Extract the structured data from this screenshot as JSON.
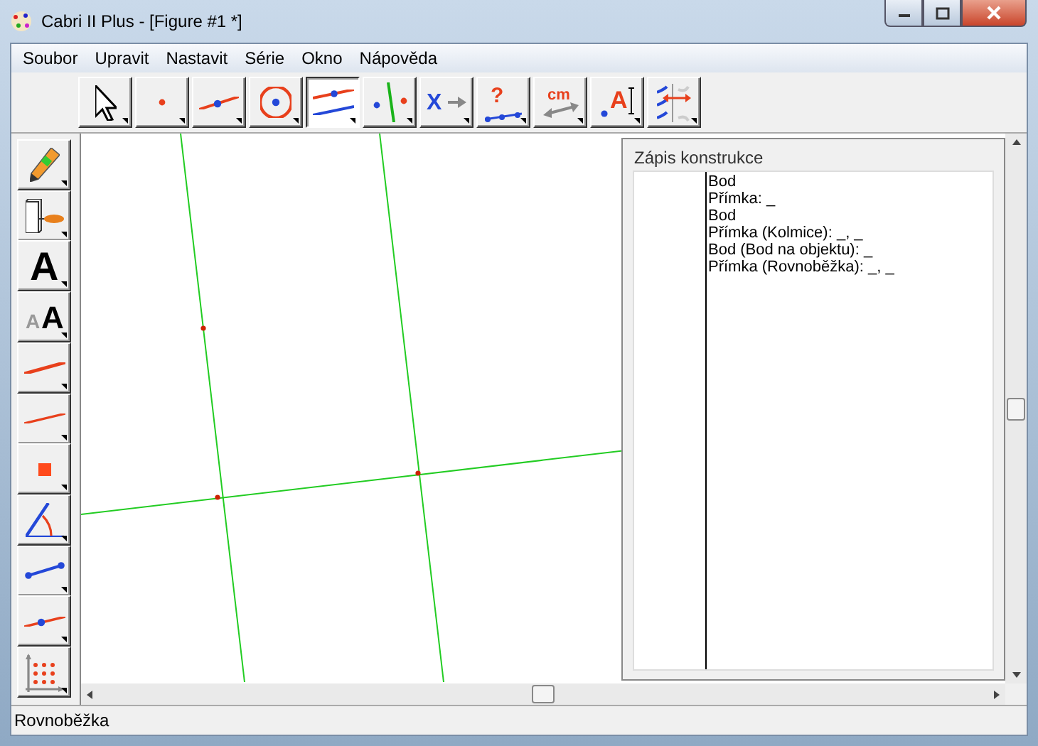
{
  "window": {
    "title": "Cabri II Plus - [Figure #1 *]"
  },
  "menu": [
    "Soubor",
    "Upravit",
    "Nastavit",
    "Série",
    "Okno",
    "Nápověda"
  ],
  "toolbar": [
    {
      "kind": "pointer",
      "selected": false
    },
    {
      "kind": "point",
      "selected": false
    },
    {
      "kind": "line",
      "selected": false
    },
    {
      "kind": "circle",
      "selected": false
    },
    {
      "kind": "parallel",
      "selected": true
    },
    {
      "kind": "perpendicular",
      "selected": false
    },
    {
      "kind": "transform",
      "selected": false,
      "glyphs": [
        "X"
      ]
    },
    {
      "kind": "check",
      "selected": false,
      "glyphs": [
        "?"
      ]
    },
    {
      "kind": "measure",
      "selected": false,
      "glyphs": [
        "cm"
      ]
    },
    {
      "kind": "text",
      "selected": false,
      "glyphs": [
        "A"
      ]
    },
    {
      "kind": "attributes",
      "selected": false
    }
  ],
  "side_toolbar": [
    {
      "kind": "pencil",
      "selected": false
    },
    {
      "kind": "roller",
      "selected": false
    },
    {
      "kind": "letter",
      "selected": false,
      "glyphs": [
        "A"
      ]
    },
    {
      "kind": "letters",
      "selected": false,
      "glyphs": [
        "A",
        "A"
      ]
    },
    {
      "kind": "thickline",
      "selected": false
    },
    {
      "kind": "thinline",
      "selected": false
    },
    {
      "kind": "square",
      "selected": false
    },
    {
      "kind": "angle",
      "selected": false
    },
    {
      "kind": "segment",
      "selected": false
    },
    {
      "kind": "pointonline",
      "selected": false
    },
    {
      "kind": "grid",
      "selected": false
    }
  ],
  "construction_log": {
    "title": "Zápis konstrukce",
    "entries": [
      "Bod",
      "Přímka: _",
      "Bod",
      "Přímka (Kolmice): _, _",
      "Bod (Bod na objektu): _",
      "Přímka (Rovnoběžka): _, _"
    ]
  },
  "status_bar": "Rovnoběžka"
}
